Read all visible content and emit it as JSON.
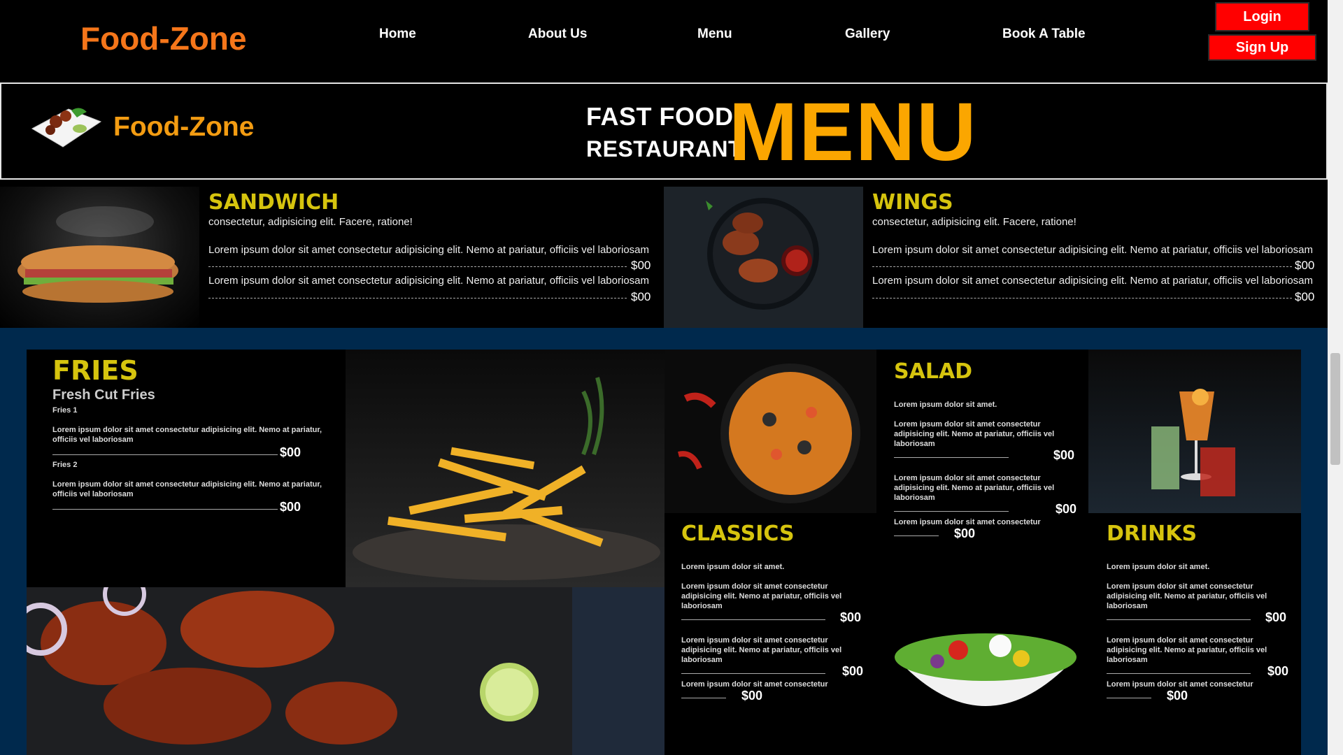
{
  "nav": {
    "brand": "Food-Zone",
    "links": [
      "Home",
      "About Us",
      "Menu",
      "Gallery",
      "Book A Table"
    ],
    "login": "Login",
    "signup": "Sign Up"
  },
  "banner": {
    "brand": "Food-Zone",
    "fast_food": "FAST FOOD",
    "restaurant": "RESTAURANT",
    "menu": "MENU"
  },
  "sandwich": {
    "title": "SANDWICH",
    "subtitle": "consectetur, adipisicing elit. Facere, ratione!",
    "items": [
      {
        "text": "Lorem ipsum dolor sit amet consectetur adipisicing elit. Nemo at pariatur, officiis vel laboriosam",
        "price": "$00"
      },
      {
        "text": "Lorem ipsum dolor sit amet consectetur adipisicing elit. Nemo at pariatur, officiis vel laboriosam",
        "price": "$00"
      }
    ]
  },
  "wings": {
    "title": "WINGS",
    "subtitle": "consectetur, adipisicing elit. Facere, ratione!",
    "items": [
      {
        "text": "Lorem ipsum dolor sit amet consectetur adipisicing elit. Nemo at pariatur, officiis vel laboriosam",
        "price": "$00"
      },
      {
        "text": "Lorem ipsum dolor sit amet consectetur adipisicing elit. Nemo at pariatur, officiis vel laboriosam",
        "price": "$00"
      }
    ]
  },
  "fries": {
    "title": "FRIES",
    "subtitle": "Fresh Cut Fries",
    "items": [
      {
        "name": "Fries 1",
        "text": "Lorem ipsum dolor sit amet consectetur adipisicing elit. Nemo at pariatur, officiis vel laboriosam",
        "price": "$00"
      },
      {
        "name": "Fries 2",
        "text": "Lorem ipsum dolor sit amet consectetur adipisicing elit. Nemo at pariatur, officiis vel laboriosam",
        "price": "$00"
      }
    ]
  },
  "salad": {
    "title": "SALAD",
    "intro": "Lorem ipsum dolor sit amet.",
    "items": [
      {
        "text": "Lorem ipsum dolor sit amet consectetur adipisicing elit. Nemo at pariatur, officiis vel laboriosam",
        "price": "$00"
      },
      {
        "text": "Lorem ipsum dolor sit amet consectetur adipisicing elit. Nemo at pariatur, officiis vel laboriosam",
        "price": "$00"
      },
      {
        "text": "Lorem ipsum dolor sit amet consectetur",
        "price": "$00"
      }
    ]
  },
  "classics": {
    "title": "CLASSICS",
    "intro": "Lorem ipsum dolor sit amet.",
    "items": [
      {
        "text": "Lorem ipsum dolor sit amet consectetur adipisicing elit. Nemo at pariatur, officiis vel laboriosam",
        "price": "$00"
      },
      {
        "text": "Lorem ipsum dolor sit amet consectetur adipisicing elit. Nemo at pariatur, officiis vel laboriosam",
        "price": "$00"
      },
      {
        "text": "Lorem ipsum dolor sit amet consectetur",
        "price": "$00"
      }
    ]
  },
  "drinks": {
    "title": "DRINKS",
    "intro": "Lorem ipsum dolor sit amet.",
    "items": [
      {
        "text": "Lorem ipsum dolor sit amet consectetur adipisicing elit. Nemo at pariatur, officiis vel laboriosam",
        "price": "$00"
      },
      {
        "text": "Lorem ipsum dolor sit amet consectetur adipisicing elit. Nemo at pariatur, officiis vel laboriosam",
        "price": "$00"
      },
      {
        "text": "Lorem ipsum dolor sit amet consectetur",
        "price": "$00"
      }
    ]
  },
  "colors": {
    "brand_orange": "#f5761a",
    "menu_yellow": "#fba600",
    "title_yellow": "#d6c40e",
    "button_red": "#ff0000",
    "lower_bg": "#00294d"
  }
}
